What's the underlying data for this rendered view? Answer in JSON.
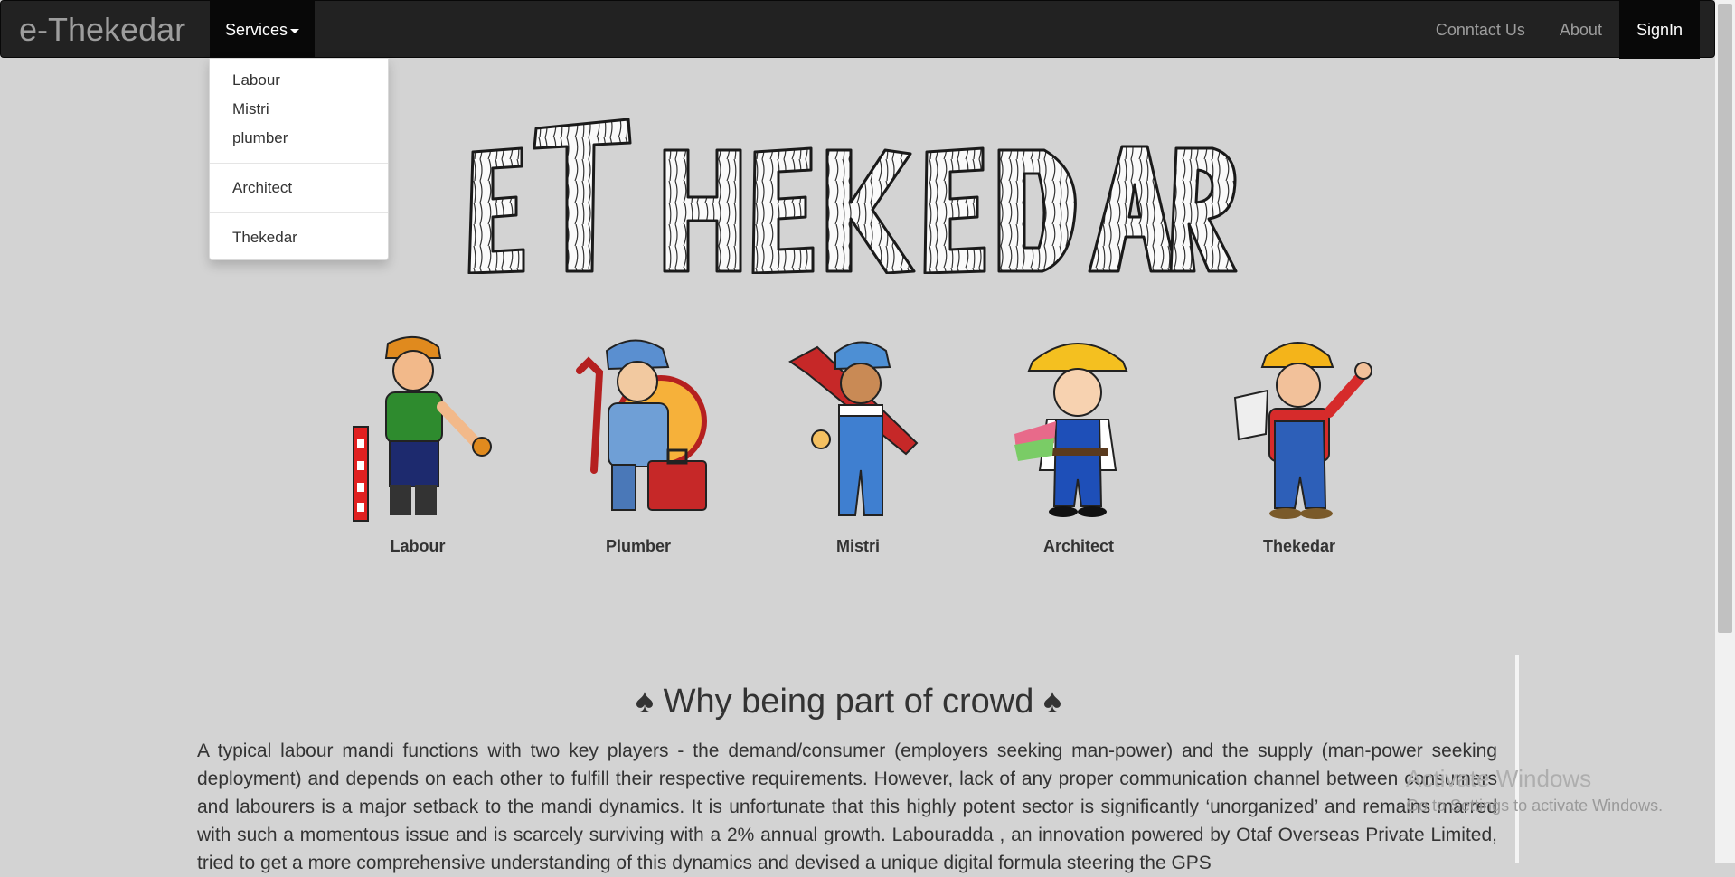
{
  "navbar": {
    "brand": "e-Thekedar",
    "services_label": "Services",
    "right_items": [
      "Conntact Us",
      "About",
      "SignIn"
    ]
  },
  "dropdown": {
    "group1": [
      "Labour",
      "Mistri",
      "plumber"
    ],
    "group2": [
      "Architect"
    ],
    "group3": [
      "Thekedar"
    ]
  },
  "logo_text": "ETHEKEDAR",
  "workers": [
    {
      "label": "Labour",
      "icon": "labour-cartoon"
    },
    {
      "label": "Plumber",
      "icon": "plumber-cartoon"
    },
    {
      "label": "Mistri",
      "icon": "mistri-cartoon"
    },
    {
      "label": "Architect",
      "icon": "architect-cartoon"
    },
    {
      "label": "Thekedar",
      "icon": "thekedar-cartoon"
    }
  ],
  "section": {
    "title": "♠ Why being part of crowd ♠",
    "paragraph": "A typical labour mandi functions with two key players - the demand/consumer (employers seeking man-power) and the supply (man-power seeking deployment) and depends on each other to fulfill their respective requirements. However, lack of any proper communication channel between consumers and labourers is a major setback to the mandi dynamics. It is unfortunate that this highly potent sector is significantly ‘unorganized’ and remains marred with such a momentous issue and is scarcely surviving with a 2% annual growth. Labouradda , an innovation powered by Otaf Overseas Private Limited, tried to get a more comprehensive understanding of this dynamics and devised a unique digital formula steering the GPS"
  },
  "watermark": {
    "line1": "Activate Windows",
    "line2": "Go to Settings to activate Windows."
  }
}
